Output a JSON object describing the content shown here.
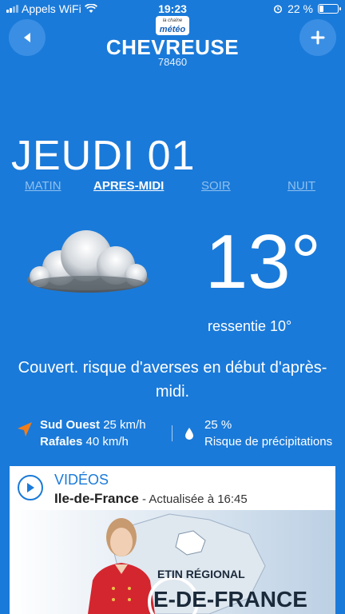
{
  "status_bar": {
    "carrier": "Appels WiFi",
    "time": "19:23",
    "battery": "22 %",
    "battery_level": 0.22
  },
  "header": {
    "logo_small": "la chaîne",
    "logo": "météo",
    "city": "CHEVREUSE",
    "postal_code": "78460",
    "back_icon": "back-arrow-icon",
    "add_icon": "plus-icon"
  },
  "forecast": {
    "day": "JEUDI 01",
    "tabs": [
      {
        "label": "MATIN",
        "active": false
      },
      {
        "label": "APRES-MIDI",
        "active": true
      },
      {
        "label": "SOIR",
        "active": false
      },
      {
        "label": "NUIT",
        "active": false
      }
    ],
    "weather_icon": "cloud-icon",
    "temperature": "13°",
    "feels_like": "ressentie 10°",
    "description": "Couvert. risque d'averses en début d'après-midi.",
    "wind_direction": "Sud Ouest",
    "wind_speed": "25 km/h",
    "gusts_label": "Rafales",
    "gusts_speed": "40 km/h",
    "precip_percent": "25 %",
    "precip_label": "Risque de précipitations"
  },
  "videos": {
    "title": "VIDÉOS",
    "region": "Ile-de-France",
    "updated": " - Actualisée à 16:45",
    "thumb_line1": "ETIN RÉGIONAL",
    "thumb_line2": "E-DE-FRANCE"
  },
  "colors": {
    "background": "#1a7ad9",
    "accent_orange": "#f07d1a",
    "tab_inactive": "#8ec0f0"
  }
}
